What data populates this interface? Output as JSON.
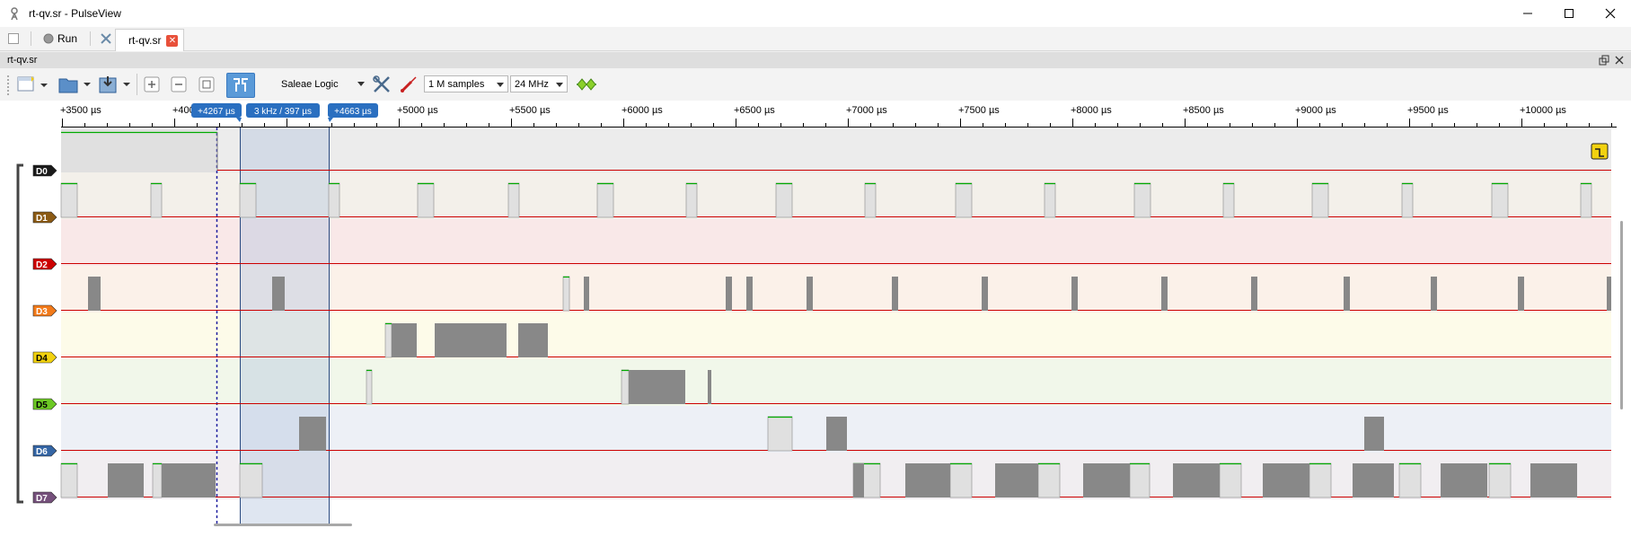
{
  "window": {
    "title": "rt-qv.sr - PulseView"
  },
  "tabs": {
    "run_label": "Run",
    "file_tab_label": "rt-qv.sr"
  },
  "dock": {
    "title": "rt-qv.sr"
  },
  "toolbar": {
    "device": "Saleae Logic",
    "samples": "1 M samples",
    "samplerate": "24 MHz"
  },
  "ruler": {
    "labels": [
      "+3500 µs",
      "+4000 µs",
      "+5000 µs",
      "+5500 µs",
      "+6000 µs",
      "+6500 µs",
      "+7000 µs",
      "+7500 µs",
      "+8000 µs",
      "+8500 µs",
      "+9000 µs",
      "+9500 µs",
      "+10000 µs"
    ],
    "cursor_a": "+4267 µs",
    "cursor_diff": "3 kHz / 397 µs",
    "cursor_b": "+4663 µs"
  },
  "channels": [
    {
      "label": "D0",
      "color": "#1a1a1a",
      "bg": "#ececec",
      "text_color": "#ffffff"
    },
    {
      "label": "D1",
      "color": "#8b5a14",
      "bg": "#f3f0ea",
      "text_color": "#ffffff"
    },
    {
      "label": "D2",
      "color": "#cc0000",
      "bg": "#f9e8e8",
      "text_color": "#ffffff"
    },
    {
      "label": "D3",
      "color": "#f27a1a",
      "bg": "#fbf1e9",
      "text_color": "#ffffff"
    },
    {
      "label": "D4",
      "color": "#f2d20f",
      "bg": "#fdfbe9",
      "text_color": "#000000"
    },
    {
      "label": "D5",
      "color": "#6cc924",
      "bg": "#f1f7ea",
      "text_color": "#000000"
    },
    {
      "label": "D6",
      "color": "#3465a4",
      "bg": "#edf0f6",
      "text_color": "#ffffff"
    },
    {
      "label": "D7",
      "color": "#75507b",
      "bg": "#f1eef1",
      "text_color": "#ffffff"
    }
  ],
  "colors": {
    "high_line": "#00aa00",
    "low_line": "#cc0000",
    "cursor_fill": "#b8c8e0",
    "cursor_flag": "#2a6fc0"
  }
}
